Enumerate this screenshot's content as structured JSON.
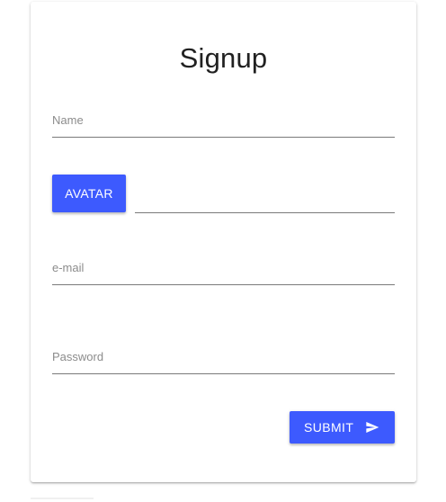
{
  "form": {
    "title": "Signup",
    "fields": {
      "name": {
        "label": "Name"
      },
      "email": {
        "label": "e-mail"
      },
      "password": {
        "label": "Password"
      }
    },
    "avatar_button": "AVATAR",
    "submit_button": "SUBMIT"
  },
  "colors": {
    "primary": "#3d5afe",
    "label": "#8c8c8c",
    "underline": "#7a7a7a",
    "title": "#212121"
  },
  "icons": {
    "submit": "send-icon"
  }
}
